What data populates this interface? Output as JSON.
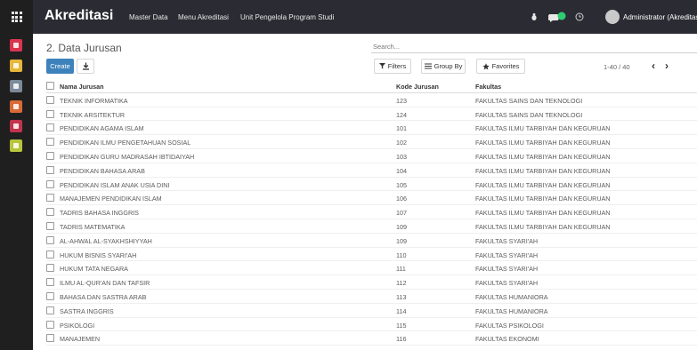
{
  "app": {
    "brand": "Akreditasi",
    "menu": [
      "Master Data",
      "Menu Akreditasi",
      "Unit Pengelola Program Studi"
    ],
    "user": "Administrator (Akreditasi"
  },
  "sidebar_apps": [
    {
      "name": "discuss-app-icon",
      "color": "#d9344f"
    },
    {
      "name": "document-app-icon",
      "color": "#e6b73a"
    },
    {
      "name": "tag-app-icon",
      "color": "#7c8a99"
    },
    {
      "name": "calendar-app-icon",
      "color": "#d96a36"
    },
    {
      "name": "people-app-icon",
      "color": "#c2334e"
    },
    {
      "name": "settings-app-icon",
      "color": "#b8c43a"
    }
  ],
  "page": {
    "title": "2. Data Jurusan",
    "search_placeholder": "Search...",
    "create_label": "Create",
    "filters_label": "Filters",
    "groupby_label": "Group By",
    "favorites_label": "Favorites",
    "pager": "1-40 / 40"
  },
  "table": {
    "headers": [
      "Nama Jurusan",
      "Kode Jurusan",
      "Fakultas"
    ],
    "rows": [
      [
        "TEKNIK INFORMATIKA",
        "123",
        "FAKULTAS SAINS DAN TEKNOLOGI"
      ],
      [
        "TEKNIK ARSITEKTUR",
        "124",
        "FAKULTAS SAINS DAN TEKNOLOGI"
      ],
      [
        "PENDIDIKAN AGAMA ISLAM",
        "101",
        "FAKULTAS ILMU TARBIYAH DAN KEGURUAN"
      ],
      [
        "PENDIDIKAN ILMU PENGETAHUAN SOSIAL",
        "102",
        "FAKULTAS ILMU TARBIYAH DAN KEGURUAN"
      ],
      [
        "PENDIDIKAN GURU MADRASAH IBTIDAIYAH",
        "103",
        "FAKULTAS ILMU TARBIYAH DAN KEGURUAN"
      ],
      [
        "PENDIDIKAN BAHASA ARAB",
        "104",
        "FAKULTAS ILMU TARBIYAH DAN KEGURUAN"
      ],
      [
        "PENDIDIKAN ISLAM ANAK USIA DINI",
        "105",
        "FAKULTAS ILMU TARBIYAH DAN KEGURUAN"
      ],
      [
        "MANAJEMEN PENDIDIKAN ISLAM",
        "106",
        "FAKULTAS ILMU TARBIYAH DAN KEGURUAN"
      ],
      [
        "TADRIS BAHASA INGGRIS",
        "107",
        "FAKULTAS ILMU TARBIYAH DAN KEGURUAN"
      ],
      [
        "TADRIS MATEMATIKA",
        "109",
        "FAKULTAS ILMU TARBIYAH DAN KEGURUAN"
      ],
      [
        "AL-AHWAL AL-SYAKHSHIYYAH",
        "109",
        "FAKULTAS SYARI'AH"
      ],
      [
        "HUKUM BISNIS SYARI'AH",
        "110",
        "FAKULTAS SYARI'AH"
      ],
      [
        "HUKUM TATA NEGARA",
        "111",
        "FAKULTAS SYARI'AH"
      ],
      [
        "ILMU AL-QUR'AN DAN TAFSIR",
        "112",
        "FAKULTAS SYARI'AH"
      ],
      [
        "BAHASA DAN SASTRA ARAB",
        "113",
        "FAKULTAS HUMANIORA"
      ],
      [
        "SASTRA INGGRIS",
        "114",
        "FAKULTAS HUMANIORA"
      ],
      [
        "PSIKOLOGI",
        "115",
        "FAKULTAS PSIKOLOGI"
      ],
      [
        "MANAJEMEN",
        "116",
        "FAKULTAS EKONOMI"
      ]
    ]
  },
  "colors": {
    "topbar": "#2b2c33",
    "appbar": "#1f1f1f",
    "primary": "#3e82bc",
    "chat_badge": "#2ecc71"
  }
}
